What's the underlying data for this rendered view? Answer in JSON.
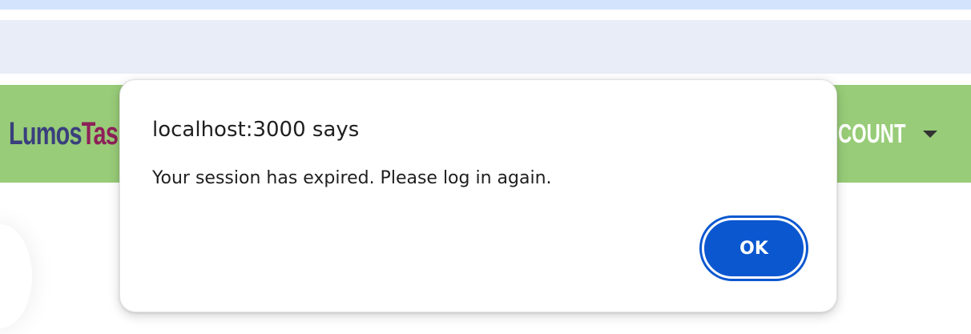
{
  "browser": {
    "strip_color": "#d3e3fd",
    "band_color": "#e9edf7"
  },
  "navbar": {
    "color": "#98cc78",
    "brand_part1": "Lumos",
    "brand_part2": "Tas",
    "account_label": "COUNT"
  },
  "dialog": {
    "title": "localhost:3000 says",
    "message": "Your session has expired. Please log in again.",
    "ok_label": "OK",
    "accent_color": "#0b57d0"
  }
}
